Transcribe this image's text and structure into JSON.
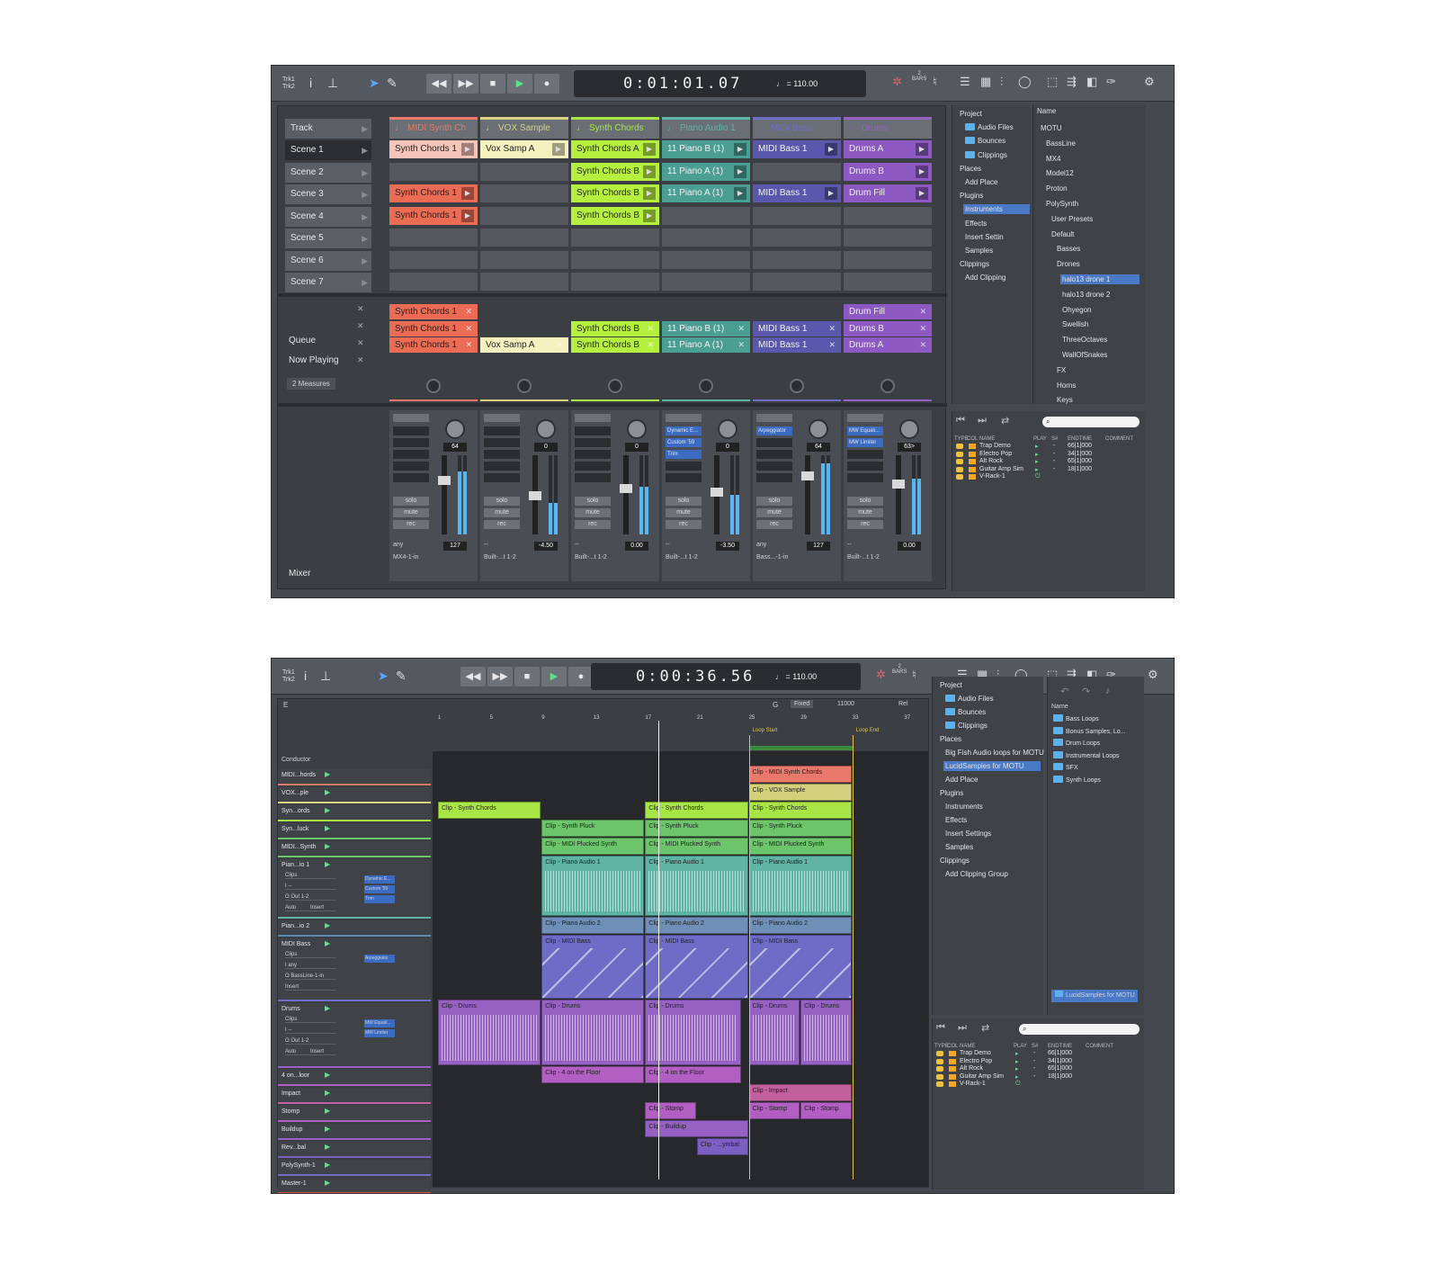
{
  "top": {
    "trk": "Trk1\nTrk2",
    "clock": "0:01:01.07",
    "tempo": "♩ = 110.00",
    "bars": "2\nBARS",
    "header": {
      "track": "Track",
      "tracks": [
        {
          "name": "MIDI Synth Ch",
          "color": "#e8796b"
        },
        {
          "name": "VOX Sample",
          "color": "#d7d37e"
        },
        {
          "name": "Synth Chords",
          "color": "#a7e644"
        },
        {
          "name": "Piano Audio 1",
          "color": "#5fb4a4"
        },
        {
          "name": "MIDI Bass",
          "color": "#6f6cc8"
        },
        {
          "name": "Drums",
          "color": "#9561c2"
        }
      ]
    },
    "scenes": [
      "Scene 1",
      "Scene 2",
      "Scene 3",
      "Scene 4",
      "Scene 5",
      "Scene 6",
      "Scene 7"
    ],
    "clips": [
      [
        "Synth Chords 1",
        "Vox Samp A",
        "Synth Chords A",
        "11 Piano B (1)",
        "MIDI Bass 1",
        "Drums A"
      ],
      [
        "",
        "",
        "Synth Chords B",
        "11 Piano A (1)",
        "",
        "Drums B"
      ],
      [
        "Synth Chords 1",
        "",
        "Synth Chords B",
        "11 Piano A (1)",
        "MIDI Bass 1",
        "Drum Fill"
      ],
      [
        "Synth Chords 1",
        "",
        "Synth Chords B",
        "",
        "",
        ""
      ]
    ],
    "clip_colors": [
      "#ec6b55",
      "#f4f1bf",
      "#b6f03e",
      "#4b9e92",
      "#5b57ad",
      "#8c58c2"
    ],
    "first_clip_color": "#f6c4b8",
    "queue_label": "Queue",
    "now_playing_label": "Now Playing",
    "measures": "2 Measures",
    "queue": [
      [
        "Synth Chords 1",
        "",
        "",
        "",
        "",
        "Drum Fill"
      ],
      [
        "Synth Chords 1",
        "",
        "Synth Chords B",
        "11 Piano B (1)",
        "MIDI Bass 1",
        "Drums B"
      ],
      [
        "Synth Chords 1",
        "Vox Samp A",
        "Synth Chords B",
        "11 Piano A (1)",
        "MIDI Bass 1",
        "Drums A"
      ]
    ],
    "mixer_label": "Mixer",
    "strips": [
      {
        "pan": "64",
        "vol": "127",
        "input": "any",
        "out": "MX4-1-in",
        "plugs": [],
        "level": 0.8
      },
      {
        "pan": "0",
        "vol": "-4.50",
        "input": "--",
        "out": "Built-...t 1-2",
        "plugs": [],
        "level": 0.4
      },
      {
        "pan": "0",
        "vol": "0.00",
        "input": "--",
        "out": "Built-...t 1-2",
        "plugs": [],
        "level": 0.6
      },
      {
        "pan": "0",
        "vol": "-3.50",
        "input": "--",
        "out": "Built-...t 1-2",
        "plugs": [
          "Dynamic E...",
          "Custom '59",
          "Trim"
        ],
        "level": 0.5
      },
      {
        "pan": "64",
        "vol": "127",
        "input": "any",
        "out": "Bass...-1-in",
        "plugs": [
          "Arpeggiator"
        ],
        "level": 0.9
      },
      {
        "pan": "63>",
        "vol": "0.00",
        "input": "--",
        "out": "Built-...t 1-2",
        "plugs": [
          "MW Equali...",
          "MW Limiter"
        ],
        "level": 0.7
      }
    ],
    "strip_btns": [
      "solo",
      "mute",
      "rec"
    ],
    "tree": [
      "Project",
      "Audio Files",
      "Bounces",
      "Clippings",
      "Places",
      "Add Place",
      "Plugins",
      "Instruments",
      "Effects",
      "Insert Settin",
      "Samples",
      "Clippings",
      "Add Clipping"
    ],
    "name_col": "Name",
    "browser": [
      "MOTU",
      "BassLine",
      "MX4",
      "Model12",
      "Proton",
      "PolySynth",
      "User Presets",
      "Default",
      "Basses",
      "Drones",
      "halo13 drone 1",
      "halo13 drone 2",
      "Ohyegon",
      "Swellish",
      "ThreeOctaves",
      "WallOfSnakes",
      "FX",
      "Horns",
      "Keys"
    ],
    "table_head": [
      "TYPE",
      "COL",
      "NAME",
      "PLAY",
      "S#",
      "ENDTIME",
      "COMMENT"
    ],
    "table": [
      [
        "Trap Demo",
        "▸",
        "-",
        "66|1|000"
      ],
      [
        "Electro Pop",
        "▸",
        "-",
        "34|1|000"
      ],
      [
        "Alt Rock",
        "▸",
        "-",
        "65|1|000"
      ],
      [
        "Guitar Amp Sim",
        "▸",
        "-",
        "18|1|000"
      ],
      [
        "V-Rack-1",
        "⏻",
        "",
        ""
      ]
    ]
  },
  "bottom": {
    "trk": "Trk1\nTrk2",
    "clock": "0:00:36.56",
    "tempo": "♩ = 110.00",
    "bars": "2\nBARS",
    "e_label": "E",
    "grid": {
      "g": "G",
      "fixed": "Fixed",
      "num": "11000",
      "rel": "Rel"
    },
    "ruler": [
      "1",
      "5",
      "9",
      "13",
      "17",
      "21",
      "25",
      "29",
      "33",
      "37"
    ],
    "loop_start": "Loop Start",
    "loop_end": "Loop End",
    "conductor": "Conductor",
    "tracks": [
      {
        "name": "MIDI...hords",
        "color": "#e8796b"
      },
      {
        "name": "VOX...ple",
        "color": "#d7d37e"
      },
      {
        "name": "Syn...ords",
        "color": "#a7e644"
      },
      {
        "name": "Syn...luck",
        "color": "#6cc46b"
      },
      {
        "name": "MIDI...Synth",
        "color": "#6cc46b"
      },
      {
        "name": "Pian...io 1",
        "color": "#5fb4a4",
        "opts": [
          "Clips",
          "I --",
          "O Out 1-2",
          "Auto"
        ],
        "plugs": [
          "Dynamic E...",
          "Custom '59",
          "Trim"
        ],
        "insert": "Insert"
      },
      {
        "name": "Pian...io 2",
        "color": "#5f88b4"
      },
      {
        "name": "MIDI Bass",
        "color": "#6f6cc8",
        "opts": [
          "Clips",
          "I any",
          "O BassLine-1-in",
          "Insert"
        ],
        "plugs": [
          "Arpeggiator"
        ]
      },
      {
        "name": "Drums",
        "color": "#9561c2",
        "opts": [
          "Clips",
          "I --",
          "O Out 1-2",
          "Auto"
        ],
        "plugs": [
          "MW Equali...",
          "MW Limiter"
        ],
        "insert": "Insert"
      },
      {
        "name": "4 on...loor",
        "color": "#b25fc2"
      },
      {
        "name": "Impact",
        "color": "#c2609d"
      },
      {
        "name": "Stomp",
        "color": "#b25fc2"
      },
      {
        "name": "Buildup",
        "color": "#9561c2"
      },
      {
        "name": "Rev...bal",
        "color": "#7c5fc2"
      },
      {
        "name": "PolySynth-1",
        "color": "#6f6cc8"
      },
      {
        "name": "Master-1",
        "color": "#d45a4b"
      }
    ],
    "arr_clips": [
      {
        "l": "Clip - MIDI Synth Chords",
        "t": 0,
        "s": 25,
        "e": 33,
        "c": "#e8796b"
      },
      {
        "l": "Clip - VOX Sample",
        "t": 1,
        "s": 25,
        "e": 33,
        "c": "#d3cf7a"
      },
      {
        "l": "Clip - Synth Chords",
        "t": 2,
        "s": 1,
        "s2": 9,
        "c": "#a7e644"
      },
      {
        "l": "Clip - Synth Chords",
        "t": 2,
        "s": 17,
        "e": 25,
        "c": "#a7e644"
      },
      {
        "l": "Clip - Synth Chords",
        "t": 2,
        "s": 25,
        "e": 33,
        "c": "#a7e644"
      },
      {
        "l": "Clip - Synth Pluck",
        "t": 3,
        "s": 9,
        "e": 17,
        "c": "#6cc46b"
      },
      {
        "l": "Clip - Synth Pluck",
        "t": 3,
        "s": 17,
        "e": 25,
        "c": "#6cc46b"
      },
      {
        "l": "Clip - Synth Pluck",
        "t": 3,
        "s": 25,
        "e": 33,
        "c": "#6cc46b"
      },
      {
        "l": "Clip - MIDI Plucked Synth",
        "t": 4,
        "s": 9,
        "e": 17,
        "c": "#6cc46b"
      },
      {
        "l": "Clip - MIDI Plucked Synth",
        "t": 4,
        "s": 17,
        "e": 25,
        "c": "#6cc46b"
      },
      {
        "l": "Clip - MIDI Plucked Synth",
        "t": 4,
        "s": 25,
        "e": 33,
        "c": "#6cc46b"
      },
      {
        "l": "Clip - Piano Audio 1",
        "t": 5,
        "s": 9,
        "e": 17,
        "c": "#5fb4a4",
        "w": 1
      },
      {
        "l": "Clip - Piano Audio 1",
        "t": 5,
        "s": 17,
        "e": 25,
        "c": "#5fb4a4",
        "w": 1
      },
      {
        "l": "Clip - Piano Audio 1",
        "t": 5,
        "s": 25,
        "e": 33,
        "c": "#5fb4a4",
        "w": 1
      },
      {
        "l": "Clip - Piano Audio 2",
        "t": 6,
        "s": 9,
        "e": 17,
        "c": "#6f8fb8"
      },
      {
        "l": "Clip - Piano Audio 2",
        "t": 6,
        "s": 17,
        "e": 25,
        "c": "#6f8fb8"
      },
      {
        "l": "Clip - Piano Audio 2",
        "t": 6,
        "s": 25,
        "e": 33,
        "c": "#6f8fb8"
      },
      {
        "l": "Clip - MIDI Bass",
        "t": 7,
        "s": 9,
        "e": 17,
        "c": "#6f6cc8",
        "n": 1
      },
      {
        "l": "Clip - MIDI Bass",
        "t": 7,
        "s": 17,
        "e": 25,
        "c": "#6f6cc8",
        "n": 1
      },
      {
        "l": "Clip - MIDI Bass",
        "t": 7,
        "s": 25,
        "e": 33,
        "c": "#6f6cc8",
        "n": 1
      },
      {
        "l": "Clip - Drums",
        "t": 8,
        "s": 1,
        "e": 9,
        "c": "#9561c2",
        "w": 1
      },
      {
        "l": "Clip - Drums",
        "t": 8,
        "s": 9,
        "e": 17,
        "c": "#9561c2",
        "w": 1
      },
      {
        "l": "Clip - Drums",
        "t": 8,
        "s": 17,
        "e": 24.5,
        "c": "#9561c2",
        "w": 1
      },
      {
        "l": "Clip - Drums",
        "t": 8,
        "s": 25,
        "e": 29,
        "c": "#9561c2",
        "w": 1
      },
      {
        "l": "Clip - Drums",
        "t": 8,
        "s": 29,
        "e": 33,
        "c": "#9561c2",
        "w": 1
      },
      {
        "l": "Clip - 4 on the Floor",
        "t": 9,
        "s": 9,
        "e": 17,
        "c": "#b25fc2"
      },
      {
        "l": "Clip - 4 on the Floor",
        "t": 9,
        "s": 17,
        "e": 24.5,
        "c": "#b25fc2"
      },
      {
        "l": "Clip - Impact",
        "t": 10,
        "s": 25,
        "e": 33,
        "c": "#c2609d"
      },
      {
        "l": "Clip - Stomp",
        "t": 11,
        "s": 17,
        "e": 21,
        "c": "#b25fc2"
      },
      {
        "l": "Clip - Stomp",
        "t": 11,
        "s": 25,
        "e": 29,
        "c": "#b25fc2"
      },
      {
        "l": "Clip - Stomp",
        "t": 11,
        "s": 29,
        "e": 33,
        "c": "#b25fc2"
      },
      {
        "l": "Clip - Buildup",
        "t": 12,
        "s": 17,
        "e": 25,
        "c": "#9561c2"
      },
      {
        "l": "Clip - ...ymbal",
        "t": 13,
        "s": 21,
        "e": 25,
        "c": "#7c5fc2"
      }
    ],
    "tree": [
      "Project",
      "Audio Files",
      "Bounces",
      "Clippings",
      "Places",
      "Big Fish Audio loops for MOTU",
      "LucidSamples for MOTU",
      "Add Place",
      "Plugins",
      "Instruments",
      "Effects",
      "Insert Settings",
      "Samples",
      "Clippings",
      "Add Clipping Group"
    ],
    "name_col": "Name",
    "folders": [
      "Bass Loops",
      "Bonus Samples, Lo...",
      "Drum Loops",
      "Instrumental Loops",
      "SFX",
      "Synth Loops"
    ],
    "path_btn": "LucidSamples for MOTU",
    "table_head": [
      "TYPE",
      "COL",
      "NAME",
      "PLAY",
      "S#",
      "ENDTIME",
      "COMMENT"
    ],
    "table": [
      [
        "Trap Demo",
        "▸",
        "-",
        "66|1|000"
      ],
      [
        "Electro Pop",
        "▸",
        "-",
        "34|1|000"
      ],
      [
        "Alt Rock",
        "▸",
        "-",
        "65|1|000"
      ],
      [
        "Guitar Amp Sim",
        "▸",
        "-",
        "18|1|000"
      ],
      [
        "V-Rack-1",
        "⏻",
        "",
        ""
      ]
    ]
  }
}
